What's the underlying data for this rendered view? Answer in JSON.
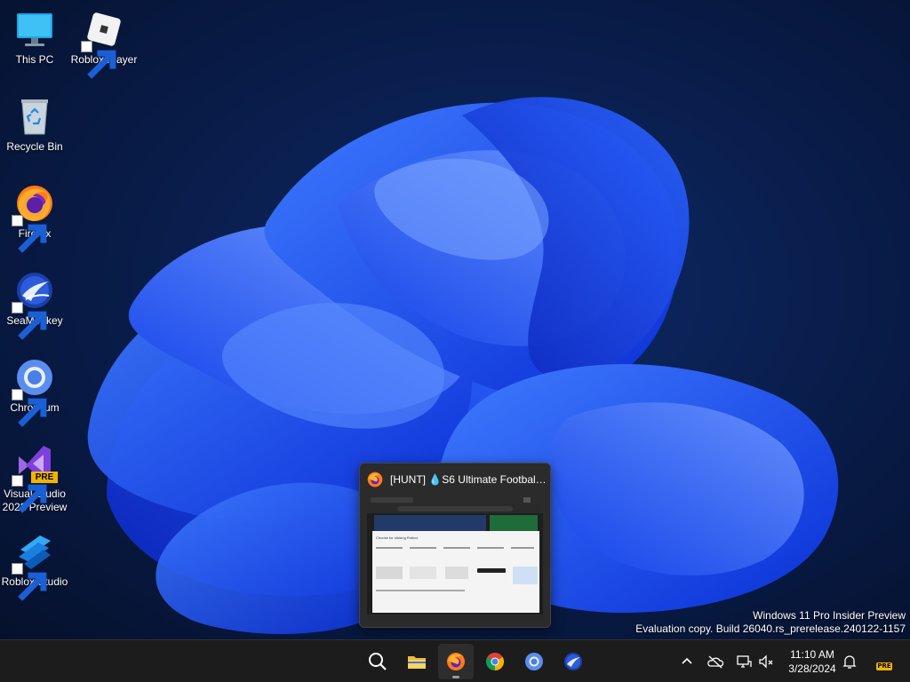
{
  "desktop": {
    "icons": [
      {
        "label": "This PC",
        "icon": "monitor-icon"
      },
      {
        "label": "Roblox Player",
        "icon": "roblox-player-icon"
      },
      {
        "label": "Recycle Bin",
        "icon": "recycle-bin-icon"
      },
      {
        "label": "Firefox",
        "icon": "firefox-icon"
      },
      {
        "label": "SeaMonkey",
        "icon": "seamonkey-icon"
      },
      {
        "label": "Chromium",
        "icon": "chromium-icon"
      },
      {
        "label": "Visual Studio 2022 Preview",
        "icon": "visual-studio-preview-icon",
        "badge": "PRE"
      },
      {
        "label": "Roblox Studio",
        "icon": "roblox-studio-icon"
      }
    ]
  },
  "window_preview": {
    "title": "[HUNT] 💧S6 Ultimate Football ...",
    "thumbnail": {
      "dialog_title": "Choose for clicking Roblox"
    }
  },
  "watermark": {
    "line1": "Windows 11 Pro Insider Preview",
    "line2": "Evaluation copy. Build 26040.rs_prerelease.240122-1157"
  },
  "taskbar": {
    "pinned": [
      "search-icon",
      "file-explorer-icon",
      "firefox-icon",
      "chrome-icon",
      "chromium-icon",
      "seamonkey-icon"
    ],
    "active": "firefox-icon",
    "tray": [
      "chevron-up-icon",
      "onedrive-icon",
      "network-icon",
      "volume-muted-icon",
      "notification-bell-icon"
    ],
    "clock": {
      "time": "11:10 AM",
      "date": "3/28/2024"
    },
    "badge": "PRE"
  },
  "colors": {
    "wallpaper_dark": "#081634",
    "bloom_blue": "#1f52ff",
    "taskbar": "#1c1c1c",
    "badge_yellow": "#f0b400"
  }
}
